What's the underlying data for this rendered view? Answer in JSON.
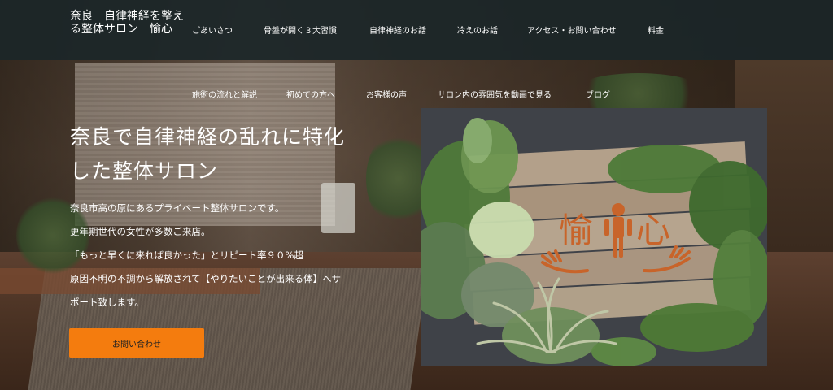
{
  "header": {
    "site_title": "奈良　自律神経を整える整体サロン　愉心",
    "nav_top": [
      "ごあいさつ",
      "骨盤が開く３大習慣",
      "自律神経のお話",
      "冷えのお話",
      "アクセス・お問い合わせ",
      "料金"
    ],
    "nav_second": [
      "施術の流れと解説",
      "初めての方へ",
      "お客様の声",
      "サロン内の雰囲気を動画で見る",
      "ブログ"
    ]
  },
  "hero": {
    "heading_line1": "奈良で自律神経の乱れに特化",
    "heading_line2": "した整体サロン",
    "paragraphs": [
      "奈良市高の原にあるプライベート整体サロンです。",
      "更年期世代の女性が多数ご来店。",
      "「もっと早くに来れば良かった」とリピート率９０%超",
      "原因不明の不調から解放されて【やりたいことが出来る体】へサ",
      "ポート致します。"
    ],
    "cta_label": "お問い合わせ"
  },
  "sign": {
    "char_left": "愉",
    "char_right": "心"
  },
  "colors": {
    "header_bg": "#1b2628",
    "cta": "#f47c0e",
    "sign_text": "#c8642a"
  }
}
